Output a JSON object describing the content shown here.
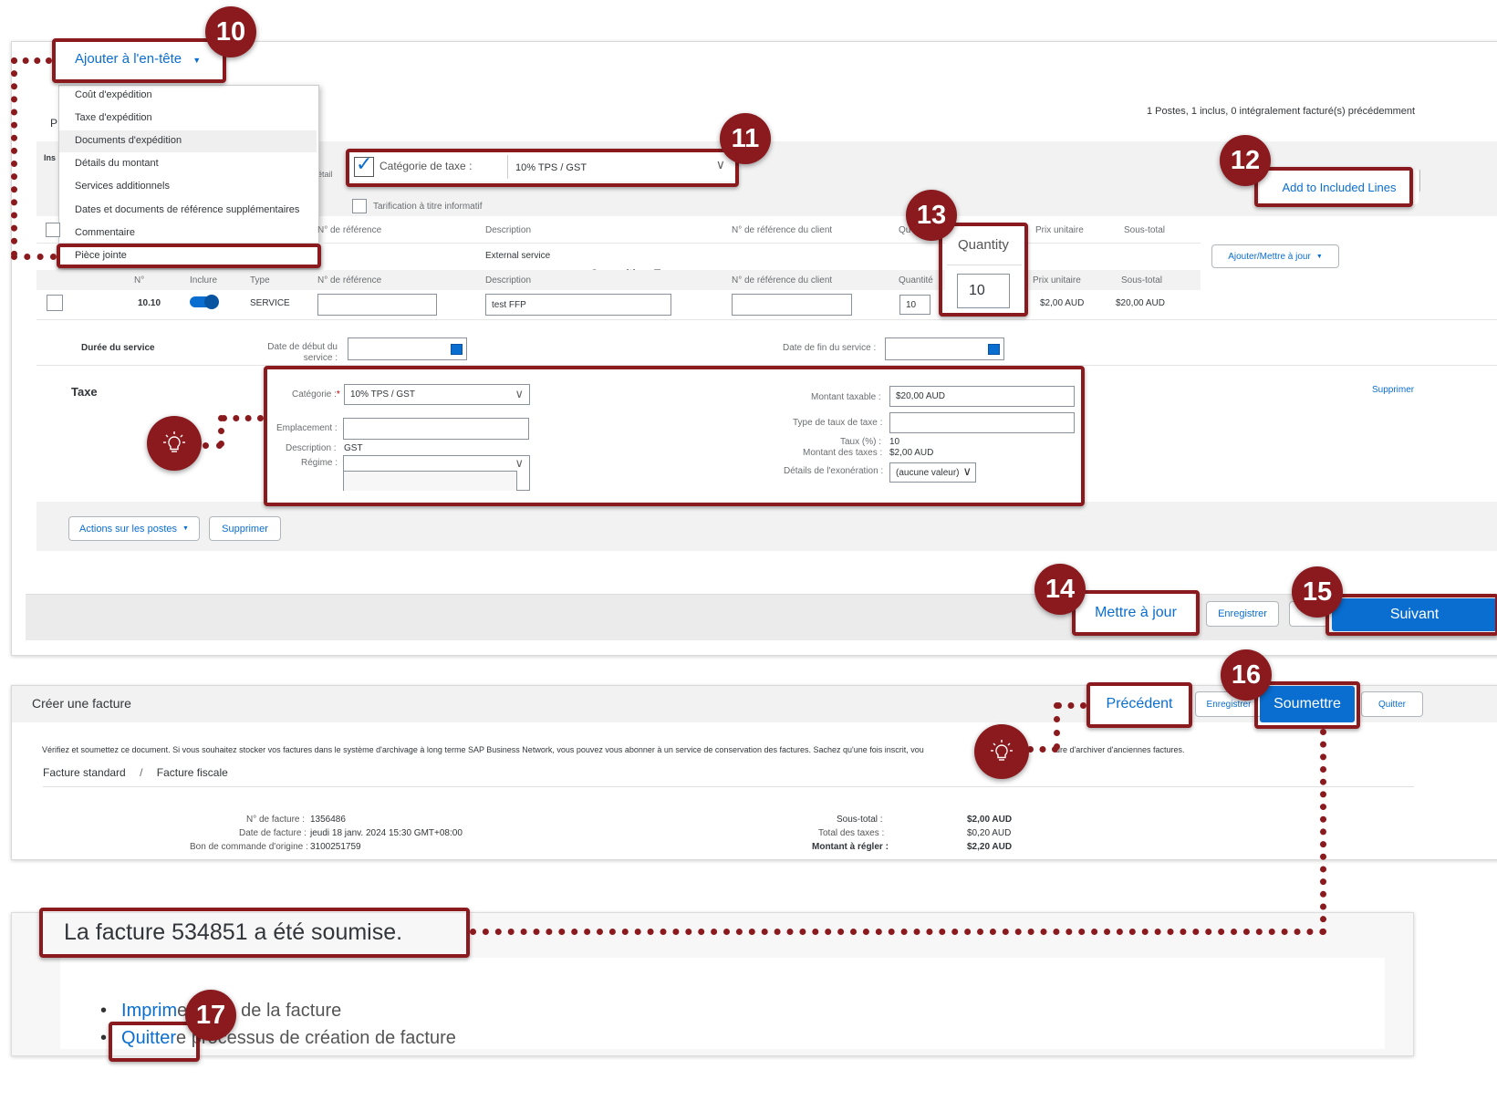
{
  "colors": {
    "accent": "#8b1a1e",
    "primary": "#0a6ed1",
    "link": "#0a6ed1"
  },
  "callouts": [
    "10",
    "11",
    "12",
    "13",
    "14",
    "15",
    "16",
    "17"
  ],
  "header": {
    "add_header_label": "Ajouter à l'en-tête",
    "summary": "1 Postes,  1 inclus,  0 intégralement facturé(s) précédemment",
    "partial_p": "P",
    "partial_ins": "Ins",
    "partial_detail": "étail"
  },
  "header_menu": {
    "items": [
      "Coût d'expédition",
      "Taxe d'expédition",
      "Documents d'expédition",
      "Détails du montant",
      "Services additionnels",
      "Dates et documents de référence supplémentaires",
      "Commentaire",
      "Pièce jointe"
    ]
  },
  "tax_category": {
    "label": "Catégorie de taxe :",
    "value": "10% TPS / GST"
  },
  "info_pricing": "Tarification à titre informatif",
  "add_included_lines": "Add to Included Lines",
  "table": {
    "headers_top": [
      "N° de référence",
      "Description",
      "N° de référence du client",
      "Qu",
      "Prix unitaire",
      "Sous-total"
    ],
    "external_service": "External service",
    "consulting_fees": "Consulting Fees",
    "quantity_callout_label": "Quantity",
    "quantity_callout_value": "10",
    "headers": [
      "N°",
      "Inclure",
      "Type",
      "N° de référence",
      "Description",
      "N° de référence du client",
      "Quantité",
      "Prix unitaire",
      "Sous-total"
    ],
    "row": {
      "num": "10.10",
      "type": "SERVICE",
      "description": "test FFP",
      "quantity": "10",
      "unit_price": "$2,00 AUD",
      "subtotal": "$20,00 AUD"
    },
    "add_update": "Ajouter/Mettre à jour"
  },
  "service": {
    "duration": "Durée du service",
    "start": "Date de début du service :",
    "end": "Date de fin du service :"
  },
  "tax": {
    "title": "Taxe",
    "delete": "Supprimer",
    "category_label": "Catégorie :",
    "category_value": "10% TPS / GST",
    "location_label": "Emplacement :",
    "description_label": "Description :",
    "description_value": "GST",
    "regime_label": "Régime :",
    "taxable_label": "Montant taxable :",
    "taxable_value": "$20,00 AUD",
    "rate_type_label": "Type de taux de taxe :",
    "rate_label": "Taux (%) :",
    "rate_value": "10",
    "tax_amount_label": "Montant des taxes :",
    "tax_amount_value": "$2,00 AUD",
    "exemption_label": "Détails de l'exonération :",
    "exemption_value": "(aucune valeur)"
  },
  "line_actions": {
    "actions": "Actions sur les postes",
    "delete": "Supprimer"
  },
  "footer": {
    "update": "Mettre à jour",
    "save": "Enregistrer",
    "next": "Suivant"
  },
  "create_invoice": {
    "title": "Créer une facture",
    "previous": "Précédent",
    "save": "Enregistrer",
    "submit": "Soumettre",
    "quit": "Quitter",
    "notice_left": "Vérifiez et soumettez ce document. Si vous souhaitez stocker vos factures dans le système d'archivage à long terme SAP Business Network, vous pouvez vous abonner à un service de conservation des factures. Sachez qu'une fois inscrit, vou",
    "notice_right": "ure d'archiver d'anciennes factures.",
    "breadcrumb_1": "Facture standard",
    "breadcrumb_sep": "/",
    "breadcrumb_2": "Facture fiscale",
    "invoice_no_label": "N° de facture :",
    "invoice_no": "1356486",
    "invoice_date_label": "Date de facture :",
    "invoice_date": "jeudi 18 janv. 2024 15:30 GMT+08:00",
    "po_label": "Bon de commande d'origine :",
    "po": "3100251759",
    "subtotal_label": "Sous-total :",
    "subtotal": "$2,00 AUD",
    "tax_total_label": "Total des taxes :",
    "tax_total": "$0,20 AUD",
    "due_label": "Montant à régler :",
    "due": "$2,20 AUD"
  },
  "confirmation": {
    "message": "La facture 534851 a été soumise.",
    "print_link": "Imprim",
    "print_rest": "e copie de la facture",
    "quit_link": "Quitter",
    "quit_rest": "e processus de création de facture"
  }
}
